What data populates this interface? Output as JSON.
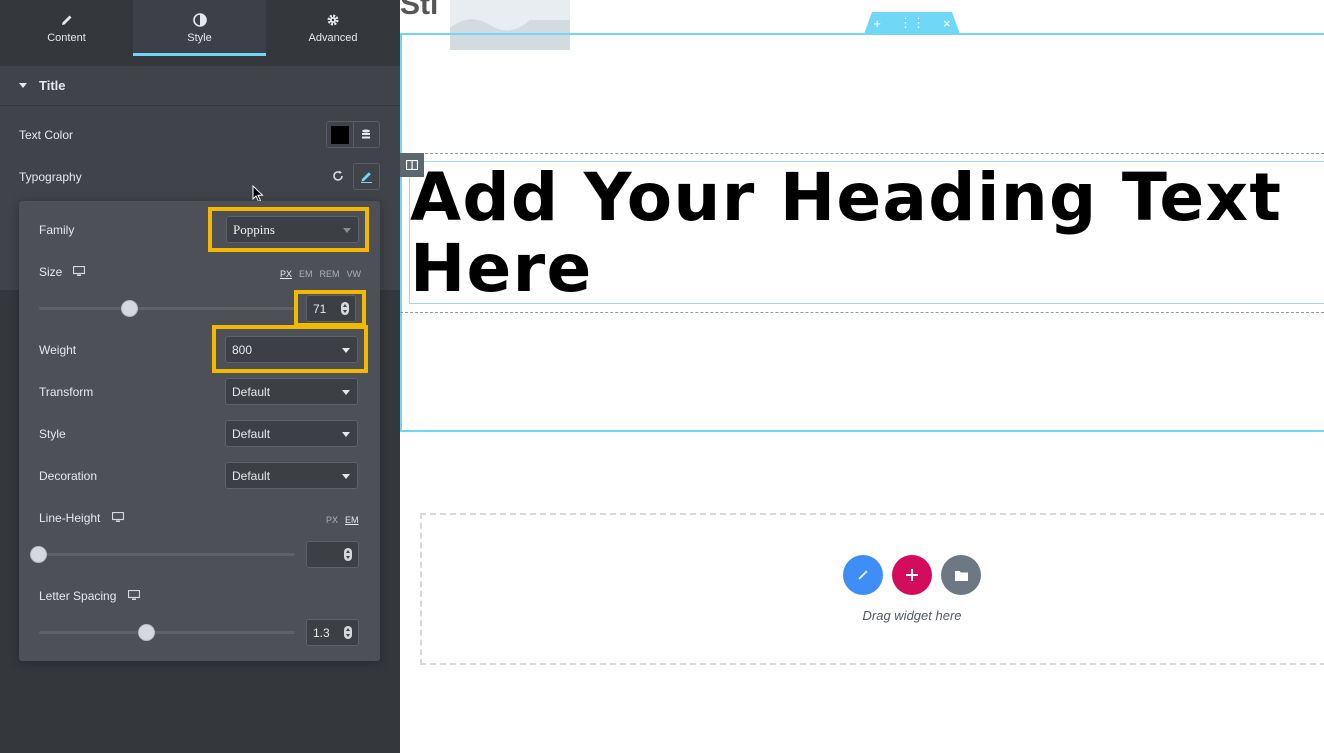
{
  "sidebar": {
    "tabs": [
      {
        "label": "Content",
        "icon": "pencil-icon"
      },
      {
        "label": "Style",
        "icon": "half-circle-icon"
      },
      {
        "label": "Advanced",
        "icon": "gear-icon"
      }
    ],
    "active_tab": "Style",
    "section_title": "Title",
    "text_color_label": "Text Color",
    "text_color_value": "#000000",
    "typography_label": "Typography"
  },
  "typography": {
    "family_label": "Family",
    "family_value": "Poppins",
    "size_label": "Size",
    "size_units": [
      "PX",
      "EM",
      "REM",
      "VW"
    ],
    "size_unit_selected": "PX",
    "size_value": "71",
    "weight_label": "Weight",
    "weight_value": "800",
    "transform_label": "Transform",
    "transform_value": "Default",
    "style_label": "Style",
    "style_value": "Default",
    "decoration_label": "Decoration",
    "decoration_value": "Default",
    "line_height_label": "Line-Height",
    "line_height_units": [
      "PX",
      "EM"
    ],
    "line_height_unit_selected": "EM",
    "line_height_value": "",
    "letter_spacing_label": "Letter Spacing",
    "letter_spacing_value": "1.3"
  },
  "canvas": {
    "top_partial_text": "Sti",
    "heading_text": "Add Your Heading Text Here",
    "drop_text": "Drag widget here",
    "section_controls": [
      "+",
      "⋮⋮",
      "×"
    ]
  },
  "colors": {
    "accent": "#71d7f7",
    "highlight": "#f5b800",
    "add_button": "#d30c5c",
    "magic_button": "#3f8ef7",
    "template_button": "#6d7882"
  }
}
